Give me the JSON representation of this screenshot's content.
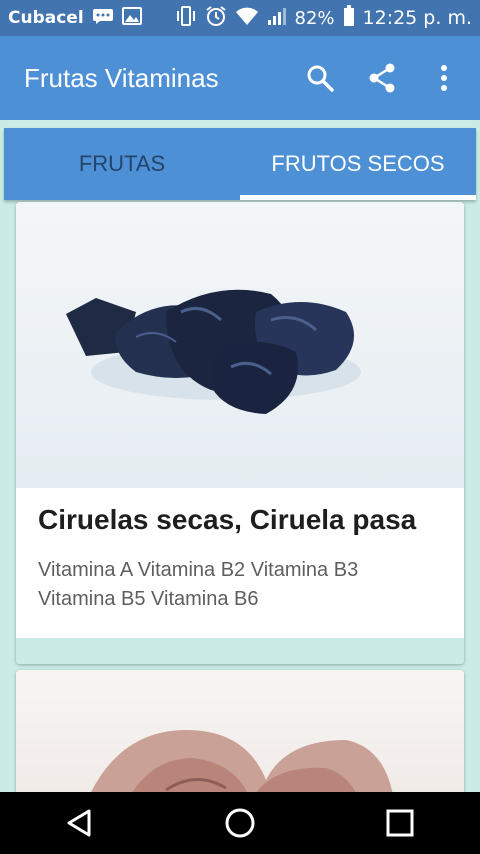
{
  "status_bar": {
    "carrier": "Cubacel",
    "battery_percent": "82%",
    "time": "12:25 p. m.",
    "icons": [
      "messages-icon",
      "image-icon",
      "vibrate-icon",
      "alarm-icon",
      "wifi-icon",
      "signal-icon",
      "battery-icon"
    ]
  },
  "app_bar": {
    "title": "Frutas Vitaminas",
    "actions": [
      "search-icon",
      "share-icon",
      "more-vert-icon"
    ]
  },
  "tabs": [
    {
      "label": "FRUTAS",
      "active": false
    },
    {
      "label": "FRUTOS SECOS",
      "active": true
    }
  ],
  "cards": [
    {
      "title": "Ciruelas secas, Ciruela pasa",
      "vitamins": "Vitamina A Vitamina B2 Vitamina B3 Vitamina B5 Vitamina B6"
    }
  ],
  "nav_bar": [
    "back-icon",
    "home-icon",
    "recents-icon"
  ],
  "colors": {
    "status_bar": "#4274b0",
    "app_bar": "#4e90d6",
    "inactive_tab_text": "#24446b",
    "background": "#c9ece6"
  }
}
